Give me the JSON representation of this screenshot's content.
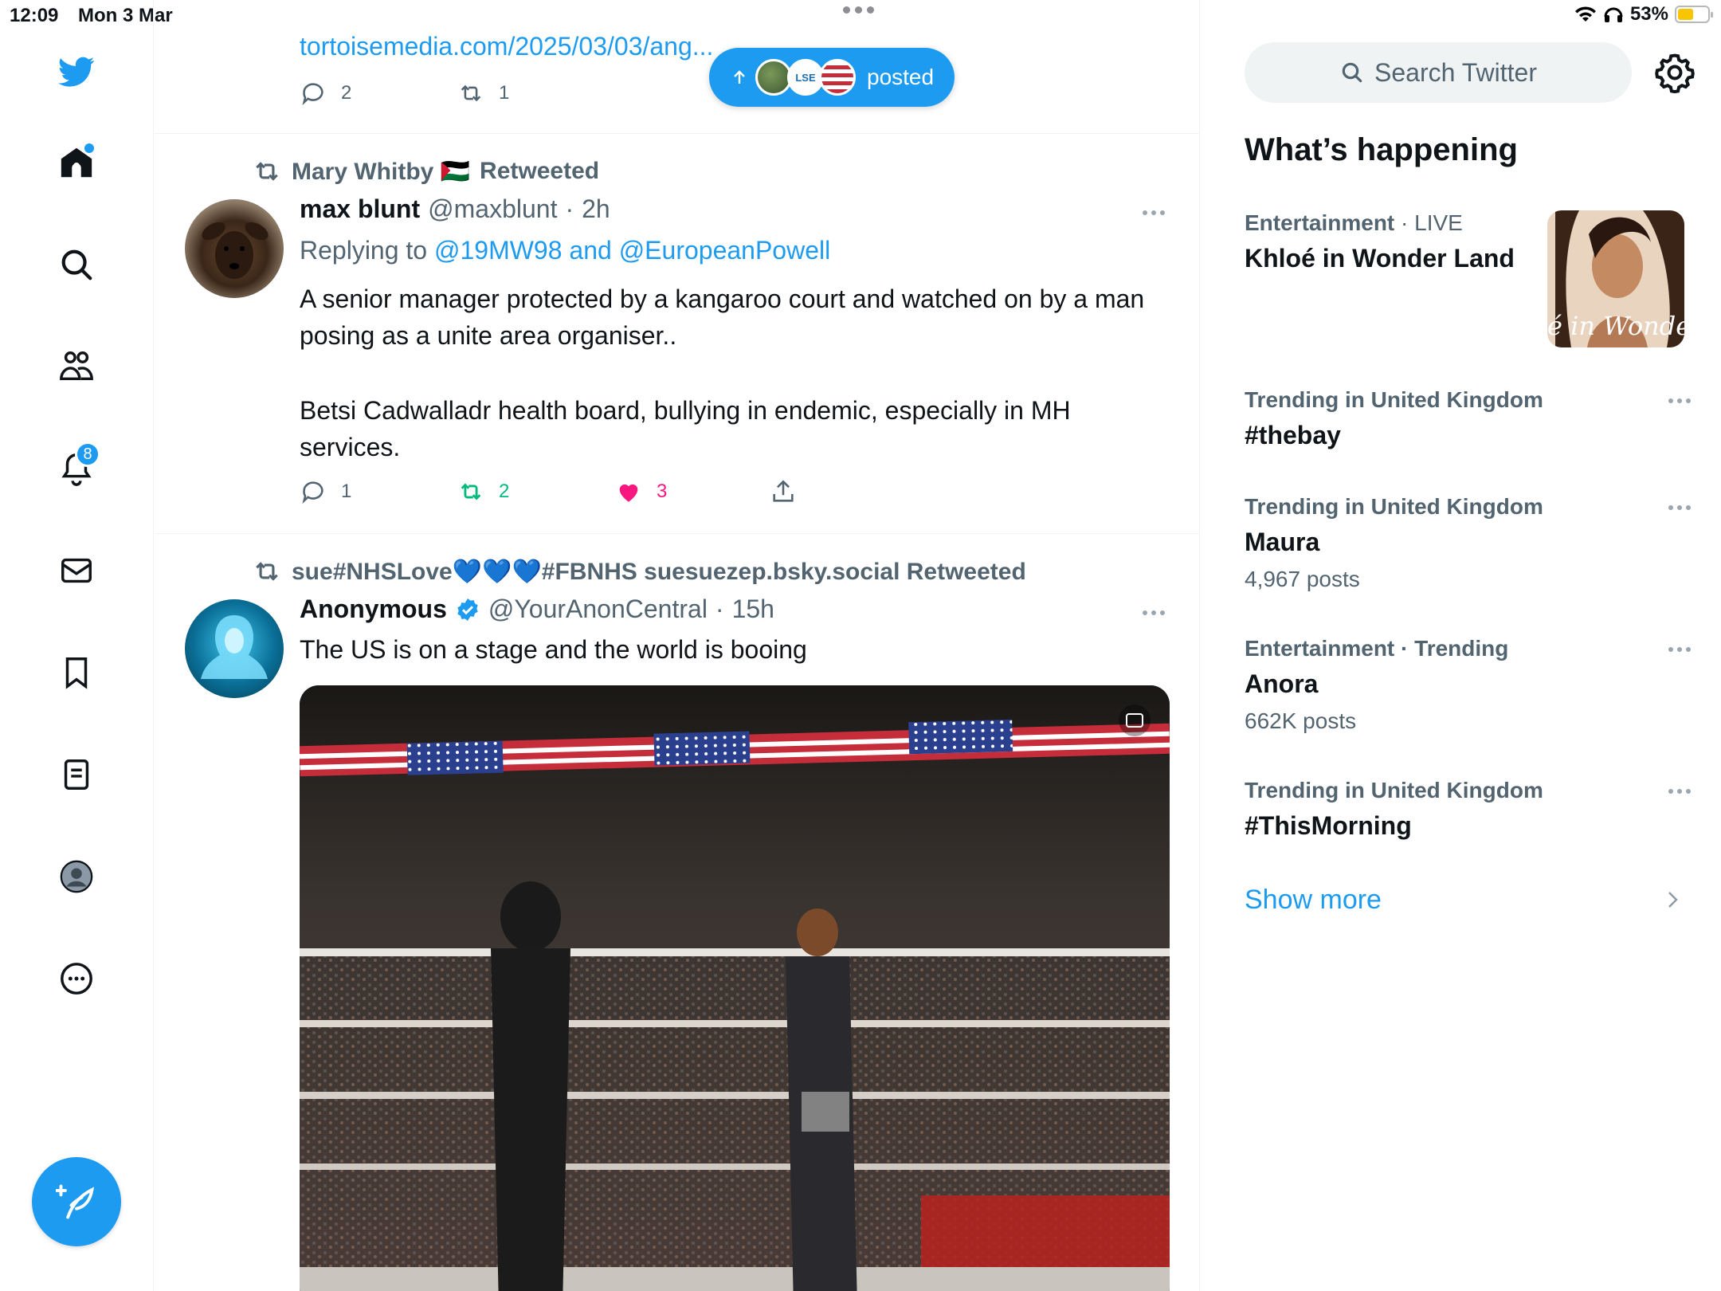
{
  "status_bar": {
    "time": "12:09",
    "date": "Mon 3 Mar",
    "battery": "53%",
    "battery_level": 0.53
  },
  "nav": {
    "notifications_badge": "8",
    "items": [
      "home-icon",
      "search-icon",
      "communities-icon",
      "notifications-icon",
      "messages-icon",
      "bookmarks-icon",
      "lists-icon",
      "profile-icon",
      "more-icon"
    ]
  },
  "timeline": {
    "new_posts_pill": {
      "label": "posted"
    },
    "tweet0": {
      "link_text": "tortoisemedia.com/2025/03/03/ang...",
      "replies": "2",
      "retweets": "1"
    },
    "tweet1": {
      "retweeted_by": "Mary Whitby 🇵🇸",
      "retweeted_suffix": "Retweeted",
      "name": "max blunt",
      "handle": "@maxblunt",
      "time": "2h",
      "replying_prefix": "Replying to",
      "replying_to": "@19MW98 and @EuropeanPowell",
      "text_p1": "A senior manager protected by a kangaroo court and watched on by a man posing as a unite area organiser..",
      "text_p2": "Betsi Cadwalladr health board, bullying in endemic, especially in MH services.",
      "replies": "1",
      "retweets": "2",
      "likes": "3"
    },
    "tweet2": {
      "retweeted_by": "sue#NHSLove💙💙💙#FBNHS suesuezep.bsky.social Retweeted",
      "name": "Anonymous",
      "handle": "@YourAnonCentral",
      "time": "15h",
      "text": "The US is on a stage and the world is booing"
    }
  },
  "sidebar": {
    "search_placeholder": "Search Twitter",
    "section_title": "What’s happening",
    "trends": [
      {
        "category": "Entertainment",
        "qualifier": "LIVE",
        "name": "Khloé in Wonder Land",
        "count": "",
        "thumb_text": "é in Wonder L"
      },
      {
        "category": "Trending in United Kingdom",
        "qualifier": "",
        "name": "#thebay",
        "count": ""
      },
      {
        "category": "Trending in United Kingdom",
        "qualifier": "",
        "name": "Maura",
        "count": "4,967 posts"
      },
      {
        "category": "Entertainment",
        "qualifier": "Trending",
        "name": "Anora",
        "count": "662K posts"
      },
      {
        "category": "Trending in United Kingdom",
        "qualifier": "",
        "name": "#ThisMorning",
        "count": ""
      }
    ],
    "show_more": "Show more"
  },
  "colors": {
    "accent": "#1d9bf0",
    "retweet_green": "#00ba7c",
    "like_pink": "#f91880",
    "text": "#0f1419",
    "muted": "#536471"
  }
}
